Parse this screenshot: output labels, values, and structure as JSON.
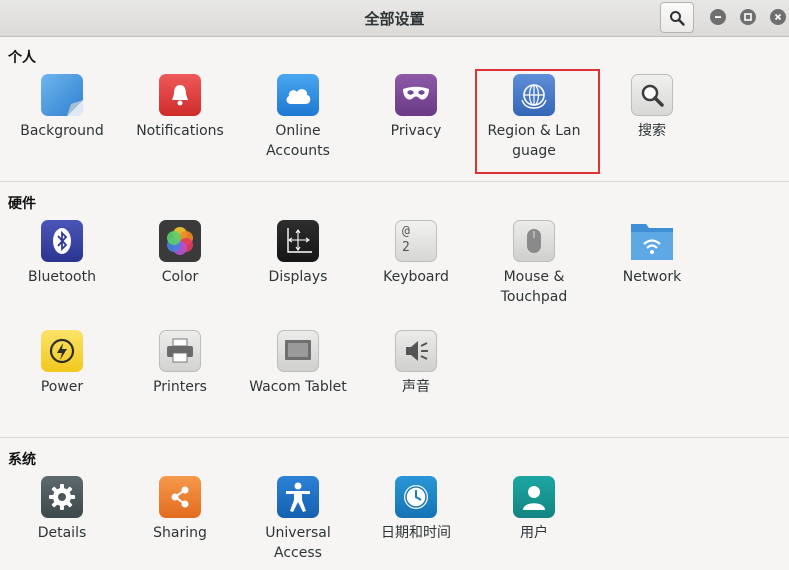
{
  "window": {
    "title": "全部设置",
    "search_icon": "search-icon",
    "controls": [
      "minimize-icon",
      "maximize-icon",
      "close-icon"
    ]
  },
  "sections": {
    "personal": {
      "title": "个人",
      "items": [
        {
          "label": "Background",
          "icon": "background-icon"
        },
        {
          "label": "Notifications",
          "icon": "bell-icon"
        },
        {
          "label": "Online\nAccounts",
          "icon": "cloud-icon"
        },
        {
          "label": "Privacy",
          "icon": "mask-icon"
        },
        {
          "label": "Region & Lan\nguage",
          "icon": "globe-un-icon"
        },
        {
          "label": "搜索",
          "icon": "magnifier-icon"
        }
      ]
    },
    "hardware": {
      "title": "硬件",
      "items": [
        {
          "label": "Bluetooth",
          "icon": "bluetooth-icon"
        },
        {
          "label": "Color",
          "icon": "color-wheel-icon"
        },
        {
          "label": "Displays",
          "icon": "display-axes-icon"
        },
        {
          "label": "Keyboard",
          "icon": "keyboard-key-icon"
        },
        {
          "label": "Mouse &\nTouchpad",
          "icon": "mouse-icon"
        },
        {
          "label": "Network",
          "icon": "network-folder-icon"
        },
        {
          "label": "Power",
          "icon": "power-bolt-icon"
        },
        {
          "label": "Printers",
          "icon": "printer-icon"
        },
        {
          "label": "Wacom Tablet",
          "icon": "tablet-icon"
        },
        {
          "label": "声音",
          "icon": "speaker-icon"
        }
      ]
    },
    "system": {
      "title": "系统",
      "items": [
        {
          "label": "Details",
          "icon": "gear-icon"
        },
        {
          "label": "Sharing",
          "icon": "share-icon"
        },
        {
          "label": "Universal\nAccess",
          "icon": "accessibility-icon"
        },
        {
          "label": "日期和时间",
          "icon": "clock-icon"
        },
        {
          "label": "用户",
          "icon": "user-icon"
        }
      ]
    }
  },
  "keyboard_key_text": {
    "top": "@",
    "bottom": "2"
  },
  "highlighted_item": "Region & Lan\nguage"
}
